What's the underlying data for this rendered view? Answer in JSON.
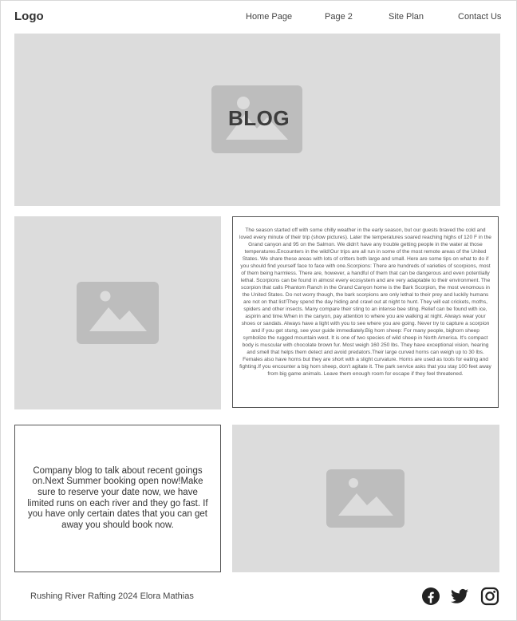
{
  "header": {
    "logo": "Logo",
    "nav": [
      "Home Page",
      "Page 2",
      "Site Plan",
      "Contact Us"
    ]
  },
  "hero": {
    "title": "BLOG",
    "image_icon": "image-placeholder-icon"
  },
  "article": {
    "text": "The season started off with some chilly weather in the early season, but our guests braved the cold and loved every minute of their trip (show pictures). Later the temperatures soared reaching highs of 120 F in the Grand canyon and 95 on the Salmon. We didn't have any trouble getting people in the water at those temperatures.Encounters in the wild!Our trips are all run in some of the most remote areas of the United States. We share these areas with lots of critters both large and small. Here are some tips on what to do if you should find yourself face to face with one.Scorpions: There are hundreds of varieties of scorpions, most of them being harmless. There are, however, a handful of them that can be dangerous and even potentially lethal. Scorpions can be found in almost every ecosystem and are very adaptable to their environment. The scorpion that calls Phantom Ranch in the Grand Canyon home is the Bark Scorpion, the most venomous in the United States. Do not worry though, the bark scorpions are only lethal to their prey and luckily humans are not on that list!They spend the day hiding and crawl out at night to hunt. They will eat crickets, moths, spiders and other insects. Many compare their sting to an intense bee sting. Relief can be found with ice, aspirin and time.When in the canyon, pay attention to where you are walking at night. Always wear your shoes or sandals. Always have a light with you to see where you are going. Never try to capture a scorpion and if you get stung, see your guide immediately.Big horn sheep: For many people, bighorn sheep symbolize the rugged mountain west. It is one of two species of wild sheep in North America. It's compact body is muscular with chocolate brown fur. Most weigh 160 250 lbs. They have exceptional vision, hearing and smell that helps them detect and avoid predators.Their large curved horns can weigh up to 30 lbs. Females also have horns but they are short with a slight curvature. Horns are used as tools for eating and fighting.If you encounter a big horn sheep, don't agitate it. The park service asks that you stay 100 feet away from big game animals. Leave them enough room for escape if they feel threatened."
  },
  "blurb": {
    "text": "Company blog to talk about recent goings on.Next Summer booking open now!Make sure to reserve your date now, we have limited runs on each river and they go fast. If you have only certain dates that you can get away you should book now."
  },
  "footer": {
    "text": "Rushing River Rafting 2024 Elora Mathias",
    "social_icons": [
      "facebook-icon",
      "twitter-icon",
      "instagram-icon"
    ]
  },
  "colors": {
    "placeholder_bg": "#dcdcdc",
    "placeholder_icon": "#bdbdbd",
    "text": "#333333",
    "border": "#555555"
  }
}
